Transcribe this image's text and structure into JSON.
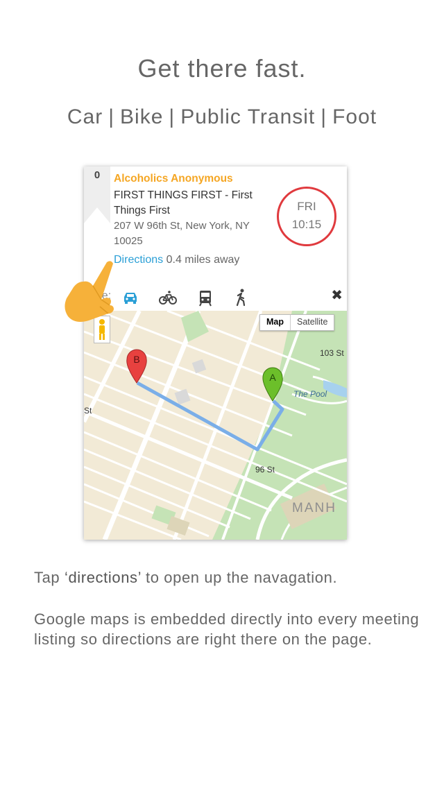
{
  "header": {
    "headline": "Get there fast.",
    "modes": [
      "Car",
      "Bike",
      "Public Transit",
      "Foot"
    ],
    "separator": "|"
  },
  "meeting": {
    "index": "0",
    "organization": "Alcoholics Anonymous",
    "name": "FIRST THINGS FIRST - First Things First",
    "address": "207 W 96th St, New York, NY 10025",
    "directions_label": "Directions",
    "distance": "0.4 miles away",
    "day": "FRI",
    "time": "10:15"
  },
  "typebar": {
    "label": "Type:",
    "modes": [
      "car-icon",
      "bike-icon",
      "transit-icon",
      "walk-icon"
    ],
    "close": "✖"
  },
  "map": {
    "toggle_map": "Map",
    "toggle_satellite": "Satellite",
    "marker_a": "A",
    "marker_b": "B",
    "label_103": "103 St",
    "label_pool": "The Pool",
    "label_st": "St",
    "label_96": "96 St",
    "label_manh": "MANH"
  },
  "caption": {
    "prefix": "Tap ",
    "highlight": "‘directions’",
    "suffix": " to open up the navagation."
  },
  "description": "Google maps is embedded directly into every meeting listing so directions are right there on the page.",
  "colors": {
    "accent_orange": "#f5a623",
    "link_blue": "#2a9fd6",
    "badge_red": "#e03a3e",
    "route_blue": "#7aaee8",
    "park_green": "#c5e3b6"
  }
}
